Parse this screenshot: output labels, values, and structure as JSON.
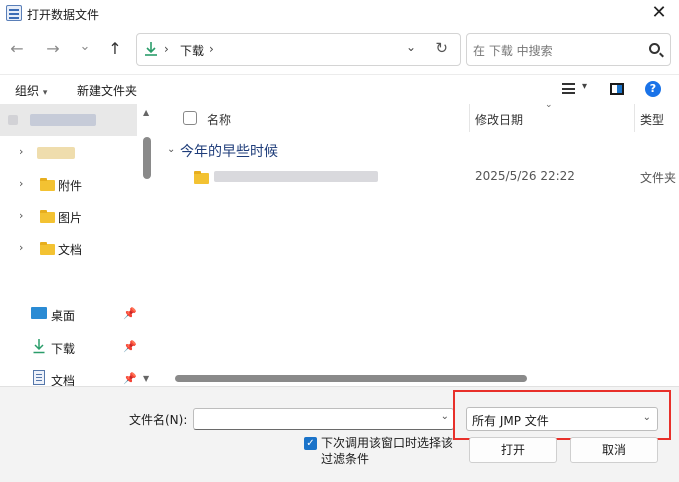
{
  "window": {
    "title": "打开数据文件",
    "close_glyph": "✕"
  },
  "nav": {
    "back_glyph": "←",
    "forward_glyph": "→",
    "recent_glyph": "⌄",
    "up_glyph": "↑",
    "address_separator": "›",
    "address_current": "下载",
    "address_dropdown_glyph": "⌄",
    "refresh_glyph": "↻"
  },
  "search": {
    "placeholder": "在 下载 中搜索"
  },
  "toolbar": {
    "organize": "组织",
    "organize_caret": "▾",
    "new_folder": "新建文件夹",
    "view_caret": "▾",
    "help_label": "?"
  },
  "sidebar": {
    "chevron": "›",
    "pin_glyph": "📌",
    "items": [
      {
        "label": "附件"
      },
      {
        "label": "图片"
      },
      {
        "label": "文档"
      }
    ],
    "quick_access": [
      {
        "label": "桌面",
        "icon": "desktop-icon"
      },
      {
        "label": "下载",
        "icon": "download-icon"
      },
      {
        "label": "文档",
        "icon": "document-icon"
      }
    ]
  },
  "columns": {
    "name": "名称",
    "date": "修改日期",
    "type": "类型",
    "sort_glyph": "⌄"
  },
  "groups": [
    {
      "title": "今年的早些时候",
      "chevron": "⌄",
      "files": [
        {
          "date": "2025/5/26 22:22",
          "type": "文件夹"
        }
      ]
    }
  ],
  "footer": {
    "filename_label": "文件名(N):",
    "filename_value": "",
    "dropdown_caret": "⌄",
    "file_type_filter": "所有 JMP 文件",
    "checkbox_checked": true,
    "checkbox_glyph": "✓",
    "checkbox_label": "下次调用该窗口时选择该过滤条件",
    "open_button": "打开",
    "cancel_button": "取消"
  },
  "colors": {
    "accent": "#1a73c9",
    "highlight_border": "#e8302a",
    "folder": "#f3c232"
  }
}
